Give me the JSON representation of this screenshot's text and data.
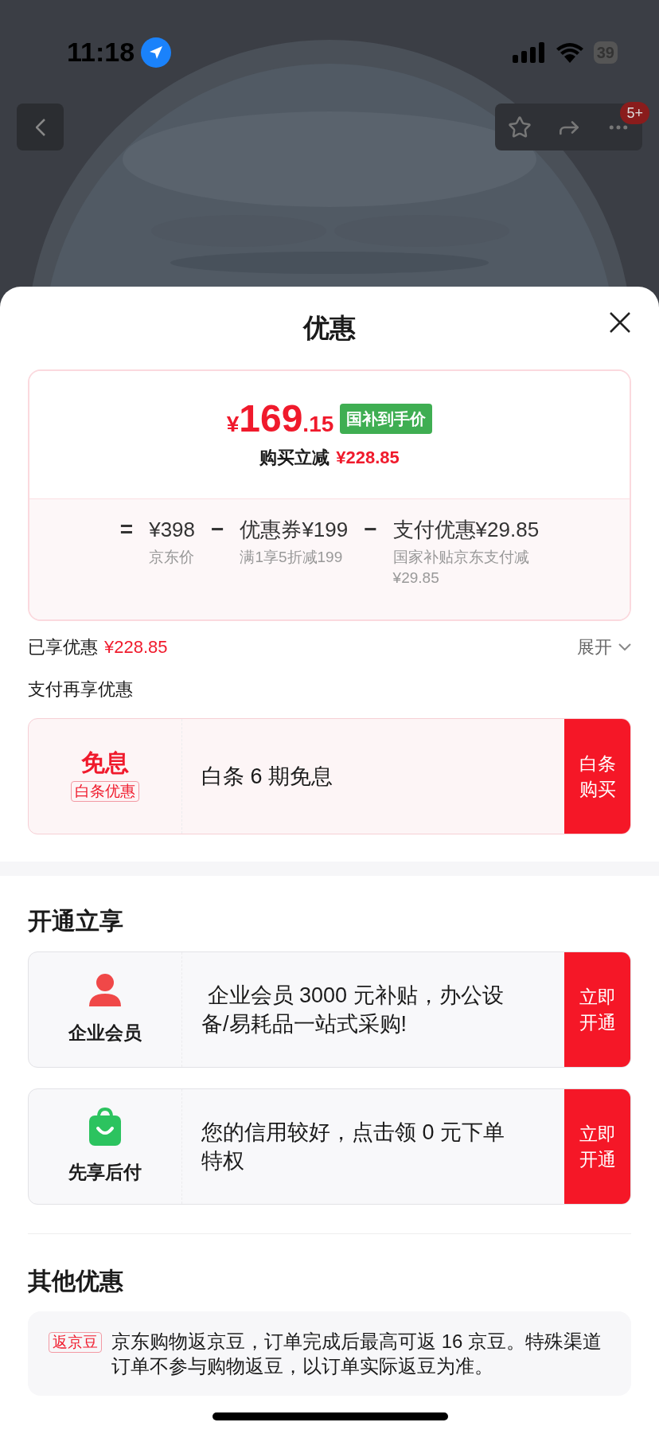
{
  "status_bar": {
    "time": "11:18",
    "battery": "39"
  },
  "nav": {
    "badge": "5+"
  },
  "sheet": {
    "title": "优惠",
    "price_card": {
      "currency": "¥",
      "integer": "169",
      "decimal": ".15",
      "tag": "国补到手价",
      "reduction_label": "购买立减",
      "reduction": "¥228.85",
      "formula": [
        {
          "kind": "operator",
          "text": "="
        },
        {
          "kind": "term",
          "value": "¥398",
          "note": "京东价"
        },
        {
          "kind": "operator",
          "text": "−"
        },
        {
          "kind": "term",
          "value": "优惠券¥199",
          "note": "满1享5折减199"
        },
        {
          "kind": "operator",
          "text": "−"
        },
        {
          "kind": "term",
          "value": "支付优惠¥29.85",
          "note": "国家补贴京东支付减¥29.85"
        }
      ]
    },
    "enjoyed": {
      "label": "已享优惠",
      "amount": "¥228.85",
      "toggle": "展开",
      "expanded": false
    },
    "pay_section": {
      "title": "支付再享优惠",
      "offers": [
        {
          "kind": "tag",
          "headline": "免息",
          "tag": "白条优惠",
          "text": "白条 6 期免息",
          "action": "白条购买"
        }
      ]
    },
    "open_section": {
      "title": "开通立享",
      "offers": [
        {
          "kind": "person",
          "label": "企业会员",
          "text": " 企业会员 3000 元补贴，办公设备/易耗品一站式采购!",
          "action": "立即开通"
        },
        {
          "kind": "bag",
          "label": "先享后付",
          "text": "您的信用较好，点击领 0 元下单特权",
          "action": "立即开通"
        }
      ]
    },
    "other_section": {
      "title": "其他优惠",
      "items": [
        {
          "tag": "返京豆",
          "text": "京东购物返京豆，订单完成后最高可返 16 京豆。特殊渠道订单不参与购物返豆，以订单实际返豆为准。"
        }
      ]
    }
  }
}
